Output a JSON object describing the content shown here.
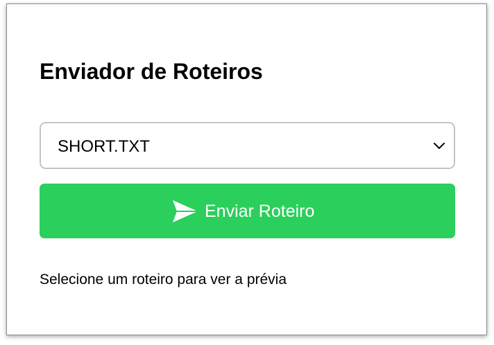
{
  "page": {
    "title": "Enviador de Roteiros"
  },
  "script_select": {
    "selected_value": "SHORT.TXT",
    "icon": "chevron-down-icon"
  },
  "send_button": {
    "label": "Enviar Roteiro",
    "icon": "paper-plane-icon",
    "color": "#2bcf5b"
  },
  "preview": {
    "hint_text": "Selecione um roteiro para ver a prévia"
  }
}
